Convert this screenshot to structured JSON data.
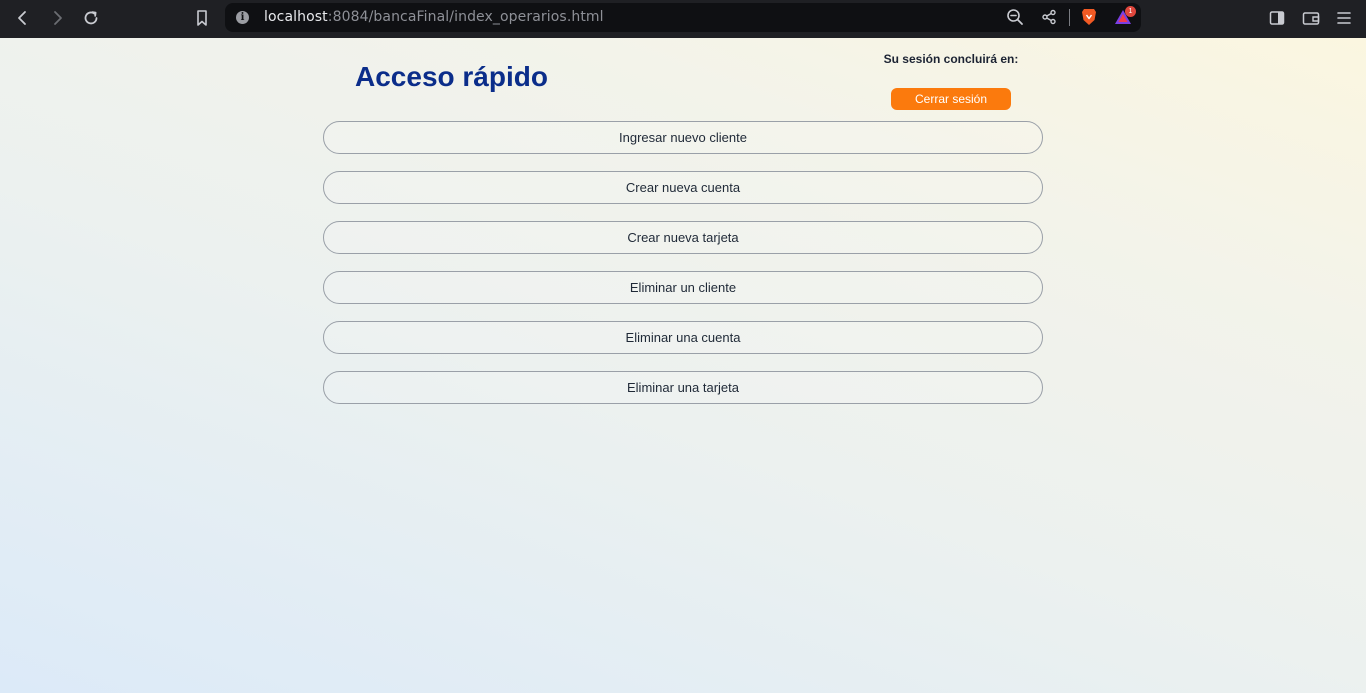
{
  "browser": {
    "url_host": "localhost",
    "url_rest": ":8084/bancaFinal/index_operarios.html",
    "notification_count": "1",
    "icons": [
      "back-icon",
      "forward-icon",
      "reload-icon",
      "bookmark-icon",
      "info-icon",
      "zoom-out-icon",
      "share-icon",
      "brave-shield-icon",
      "brave-rewards-icon",
      "sidebar-icon",
      "wallet-icon",
      "menu-icon"
    ]
  },
  "page": {
    "title": "Acceso rápido",
    "session_text": "Su sesión concluirá en:",
    "logout_label": "Cerrar sesión",
    "accent_color": "#fb7a0d",
    "title_color": "#0b2d8a",
    "actions": [
      "Ingresar nuevo cliente",
      "Crear nueva cuenta",
      "Crear nueva tarjeta",
      "Eliminar un cliente",
      "Eliminar una cuenta",
      "Eliminar una tarjeta"
    ]
  }
}
